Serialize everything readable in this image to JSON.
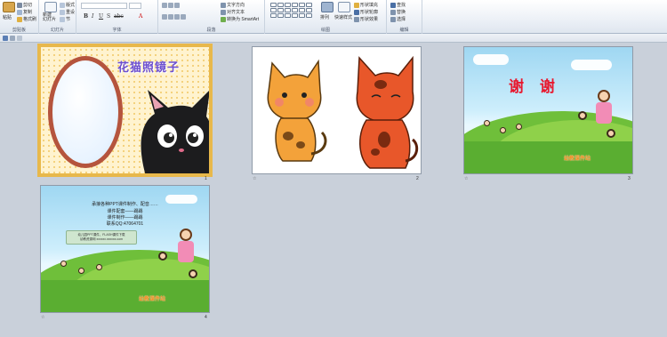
{
  "ribbon": {
    "clipboard": {
      "paste_label": "粘贴",
      "cut_label": "剪切",
      "copy_label": "复制",
      "format_painter_label": "格式刷",
      "group_label": "剪贴板"
    },
    "slides": {
      "new_slide_label": "新建\n幻灯片",
      "layout_label": "版式",
      "reset_label": "重设",
      "section_label": "节",
      "group_label": "幻灯片"
    },
    "font": {
      "group_label": "字体"
    },
    "paragraph": {
      "text_direction_label": "文字方向",
      "align_text_label": "对齐文本",
      "smartart_label": "转换为 SmartArt",
      "group_label": "段落"
    },
    "drawing": {
      "arrange_label": "排列",
      "quick_styles_label": "快速样式",
      "shape_fill_label": "形状填充",
      "shape_outline_label": "形状轮廓",
      "shape_effects_label": "形状效果",
      "group_label": "绘图"
    },
    "editing": {
      "find_label": "查找",
      "replace_label": "替换",
      "select_label": "选择",
      "group_label": "编辑"
    }
  },
  "slides": [
    {
      "number": "1",
      "title": "花猫照镜子"
    },
    {
      "number": "2"
    },
    {
      "number": "3",
      "title": "谢 谢",
      "brand": "幼教课件站"
    },
    {
      "number": "4",
      "lines": [
        "承接各种PPT课件制作、配音……",
        "课件配套——踢踢",
        "课件制作——踢踢",
        "联系QQ:47064701"
      ],
      "box_lines": [
        "幼儿园PPT课件、FLASH课件下载",
        "幼教资源网 xxxxxx.xxxxxx.com"
      ],
      "brand": "幼教课件站"
    }
  ]
}
